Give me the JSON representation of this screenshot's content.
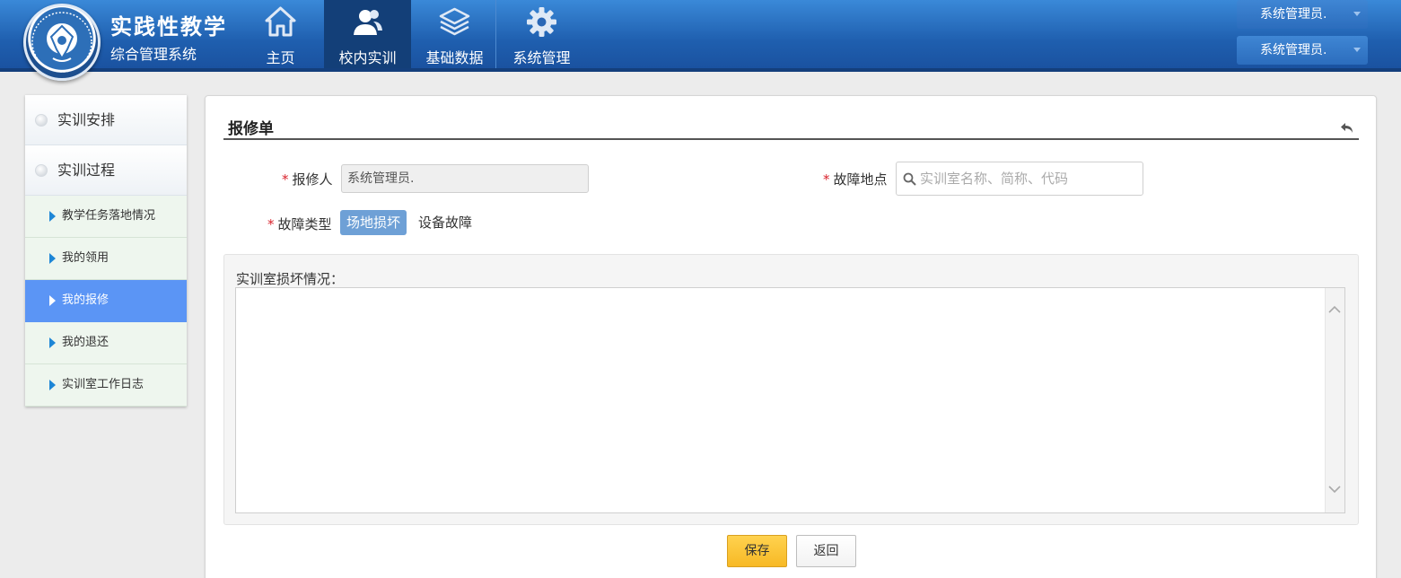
{
  "header": {
    "title": "实践性教学",
    "subtitle": "综合管理系统",
    "nav": [
      {
        "label": "主页",
        "icon": "home-icon"
      },
      {
        "label": "校内实训",
        "icon": "users-icon",
        "active": true
      },
      {
        "label": "基础数据",
        "icon": "layers-icon"
      },
      {
        "label": "系统管理",
        "icon": "gear-icon"
      }
    ],
    "users": [
      "系统管理员.",
      "系统管理员."
    ]
  },
  "sidebar": {
    "groups": [
      "实训安排",
      "实训过程"
    ],
    "items": [
      {
        "label": "教学任务落地情况"
      },
      {
        "label": "我的领用"
      },
      {
        "label": "我的报修",
        "active": true
      },
      {
        "label": "我的退还"
      },
      {
        "label": "实训室工作日志"
      }
    ]
  },
  "form": {
    "title": "报修单",
    "required_mark": "*",
    "reporter_label": "报修人",
    "reporter_value": "系统管理员.",
    "location_label": "故障地点",
    "location_placeholder": "实训室名称、简称、代码",
    "type_label": "故障类型",
    "type_options": [
      "场地损坏",
      "设备故障"
    ],
    "type_selected": "场地损坏",
    "desc_label": "实训室损坏情况：",
    "save_label": "保存",
    "back_label": "返回"
  },
  "colors": {
    "header_blue": "#1f5faf",
    "active_nav": "#133f78",
    "sidebar_active": "#5b95f5",
    "selected_option": "#6ea0d6",
    "save_button": "#f7b925",
    "required": "#d9232d"
  }
}
